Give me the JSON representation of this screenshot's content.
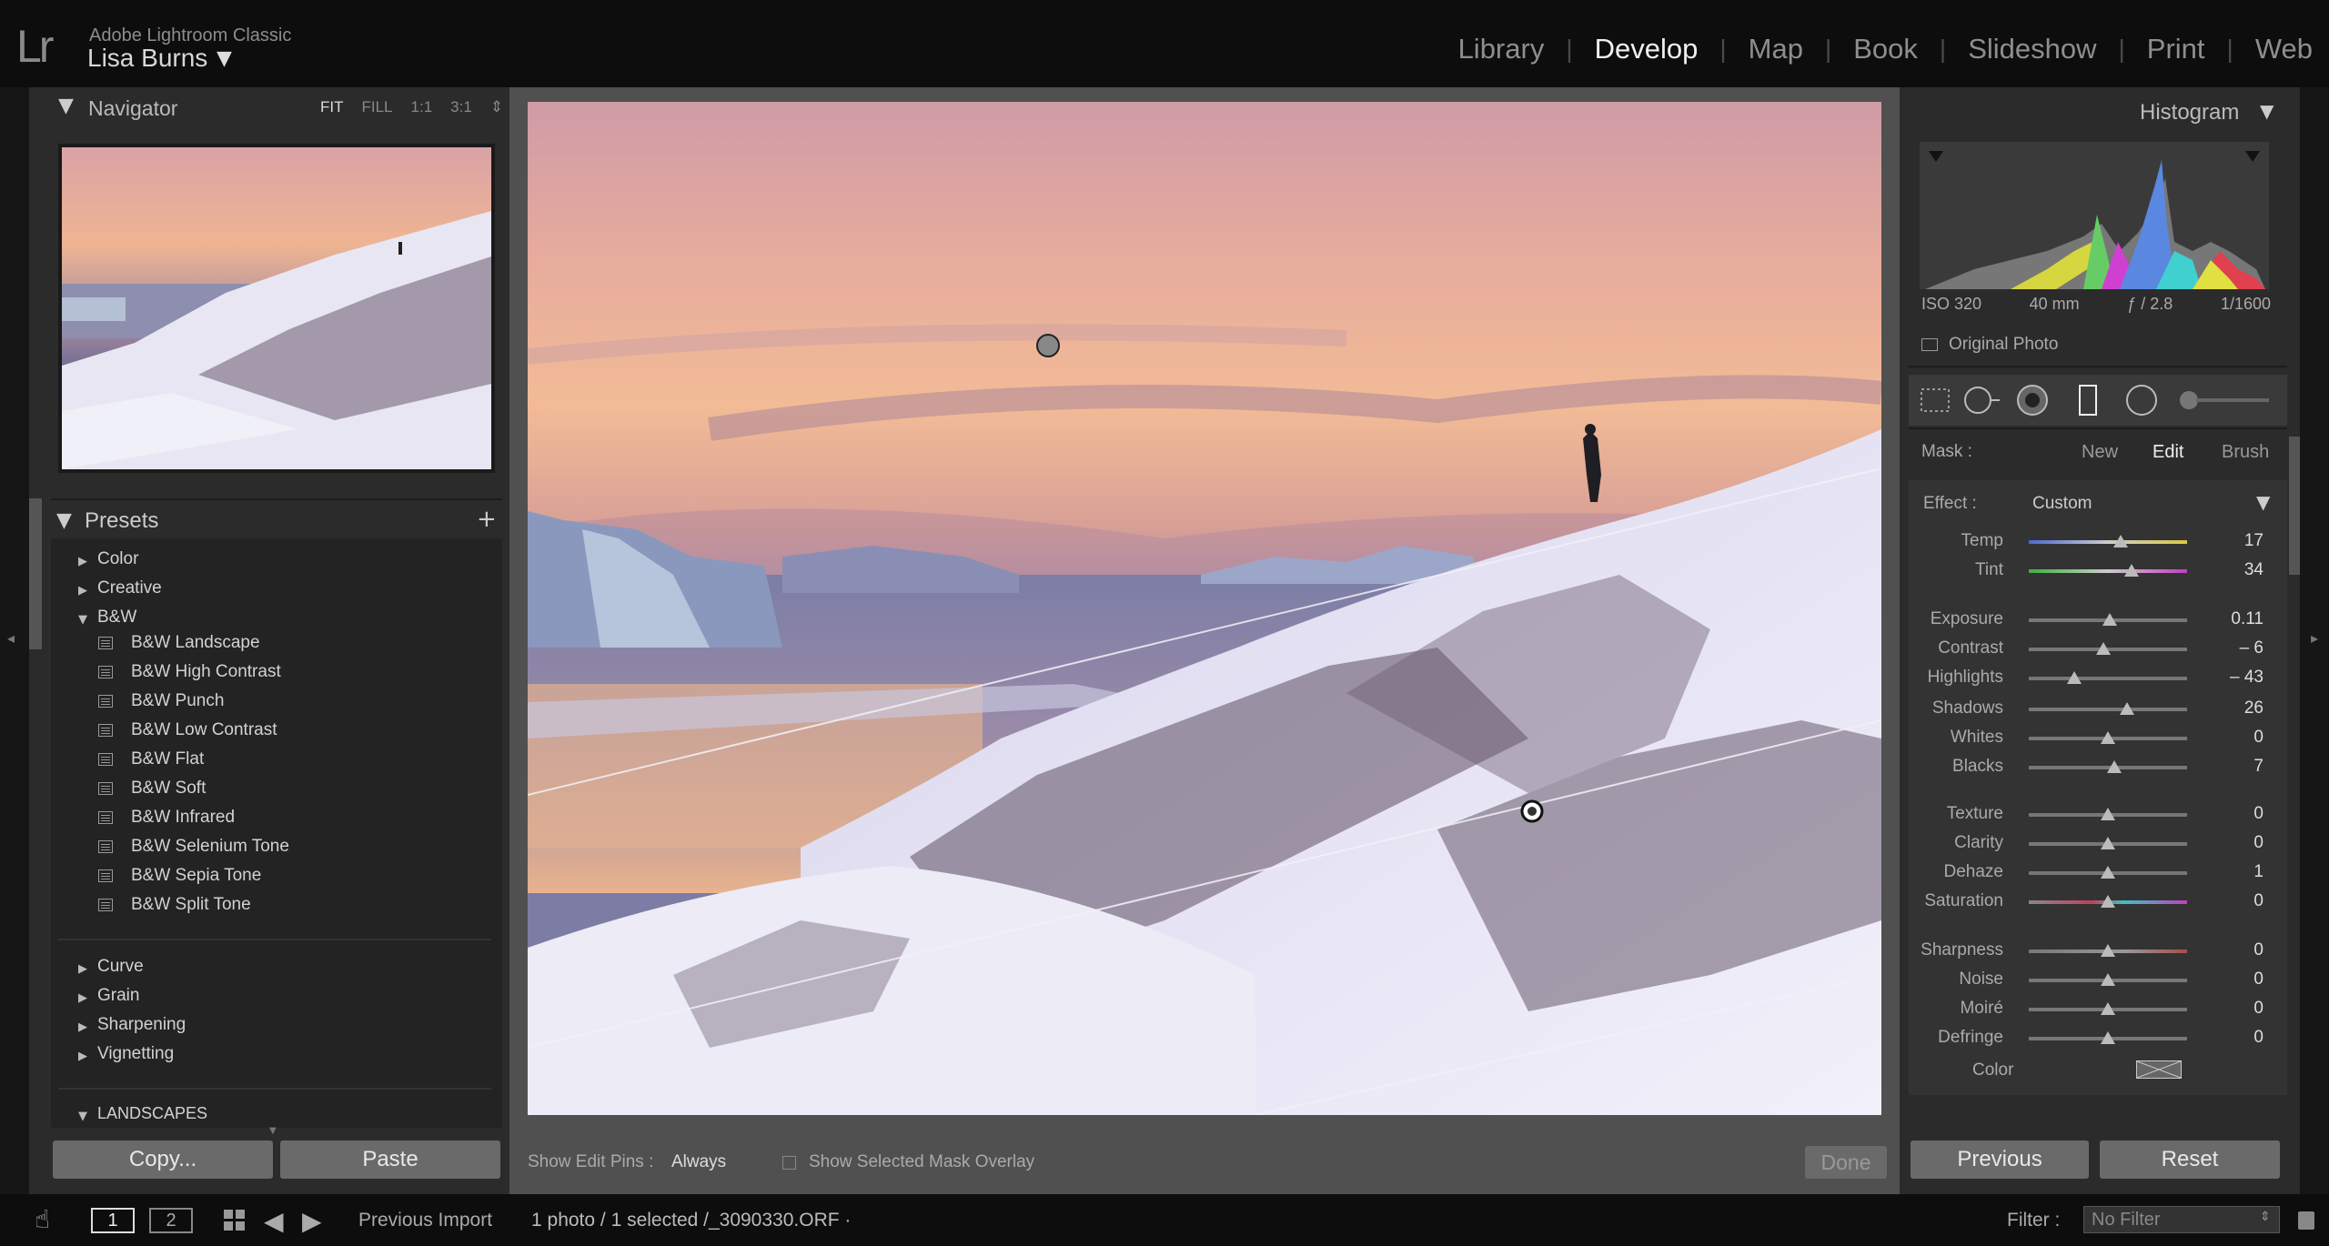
{
  "app": {
    "logo": "Lr",
    "title": "Adobe Lightroom Classic",
    "user": "Lisa Burns",
    "user_dropdown_icon": "triangle-down-icon"
  },
  "modules": [
    "Library",
    "Develop",
    "Map",
    "Book",
    "Slideshow",
    "Print",
    "Web"
  ],
  "active_module": "Develop",
  "navigator": {
    "title": "Navigator",
    "zoom_options": [
      "FIT",
      "FILL",
      "1:1",
      "3:1"
    ],
    "active_zoom": "FIT"
  },
  "presets": {
    "title": "Presets",
    "add_icon": "plus-icon",
    "groups_top": [
      "Color",
      "Creative"
    ],
    "open_group": "B&W",
    "bw_items": [
      "B&W Landscape",
      "B&W High Contrast",
      "B&W Punch",
      "B&W Low Contrast",
      "B&W Flat",
      "B&W Soft",
      "B&W Infrared",
      "B&W Selenium Tone",
      "B&W Sepia Tone",
      "B&W Split Tone"
    ],
    "groups_bottom": [
      "Curve",
      "Grain",
      "Sharpening",
      "Vignetting"
    ],
    "user_group": "LANDSCAPES"
  },
  "left_buttons": {
    "copy": "Copy...",
    "paste": "Paste"
  },
  "toolbar": {
    "show_pins_label": "Show Edit Pins :",
    "show_pins_value": "Always",
    "overlay_label": "Show Selected Mask Overlay",
    "done": "Done"
  },
  "histogram": {
    "title": "Histogram",
    "iso": "ISO 320",
    "focal": "40 mm",
    "aperture": "ƒ / 2.8",
    "shutter": "1/1600",
    "original_photo": "Original Photo"
  },
  "mask": {
    "label": "Mask :",
    "new": "New",
    "edit": "Edit",
    "brush": "Brush"
  },
  "effect": {
    "label": "Effect :",
    "value": "Custom",
    "sliders": [
      {
        "name": "Temp",
        "value": "17",
        "pos": 0.58
      },
      {
        "name": "Tint",
        "value": "34",
        "pos": 0.65
      },
      {
        "name": "Exposure",
        "value": "0.11",
        "pos": 0.51
      },
      {
        "name": "Contrast",
        "value": "– 6",
        "pos": 0.47
      },
      {
        "name": "Highlights",
        "value": "– 43",
        "pos": 0.29
      },
      {
        "name": "Shadows",
        "value": "26",
        "pos": 0.62
      },
      {
        "name": "Whites",
        "value": "0",
        "pos": 0.5
      },
      {
        "name": "Blacks",
        "value": "7",
        "pos": 0.54
      },
      {
        "name": "Texture",
        "value": "0",
        "pos": 0.5
      },
      {
        "name": "Clarity",
        "value": "0",
        "pos": 0.5
      },
      {
        "name": "Dehaze",
        "value": "1",
        "pos": 0.5
      },
      {
        "name": "Saturation",
        "value": "0",
        "pos": 0.5
      },
      {
        "name": "Sharpness",
        "value": "0",
        "pos": 0.5
      },
      {
        "name": "Noise",
        "value": "0",
        "pos": 0.5
      },
      {
        "name": "Moiré",
        "value": "0",
        "pos": 0.5
      },
      {
        "name": "Defringe",
        "value": "0",
        "pos": 0.5
      }
    ],
    "color_label": "Color"
  },
  "right_buttons": {
    "previous": "Previous",
    "reset": "Reset"
  },
  "filmstrip": {
    "view1": "1",
    "view2": "2",
    "source": "Previous Import",
    "count": "1 photo / 1 selected /_3090330.ORF ·",
    "filter_label": "Filter :",
    "filter_value": "No Filter"
  }
}
